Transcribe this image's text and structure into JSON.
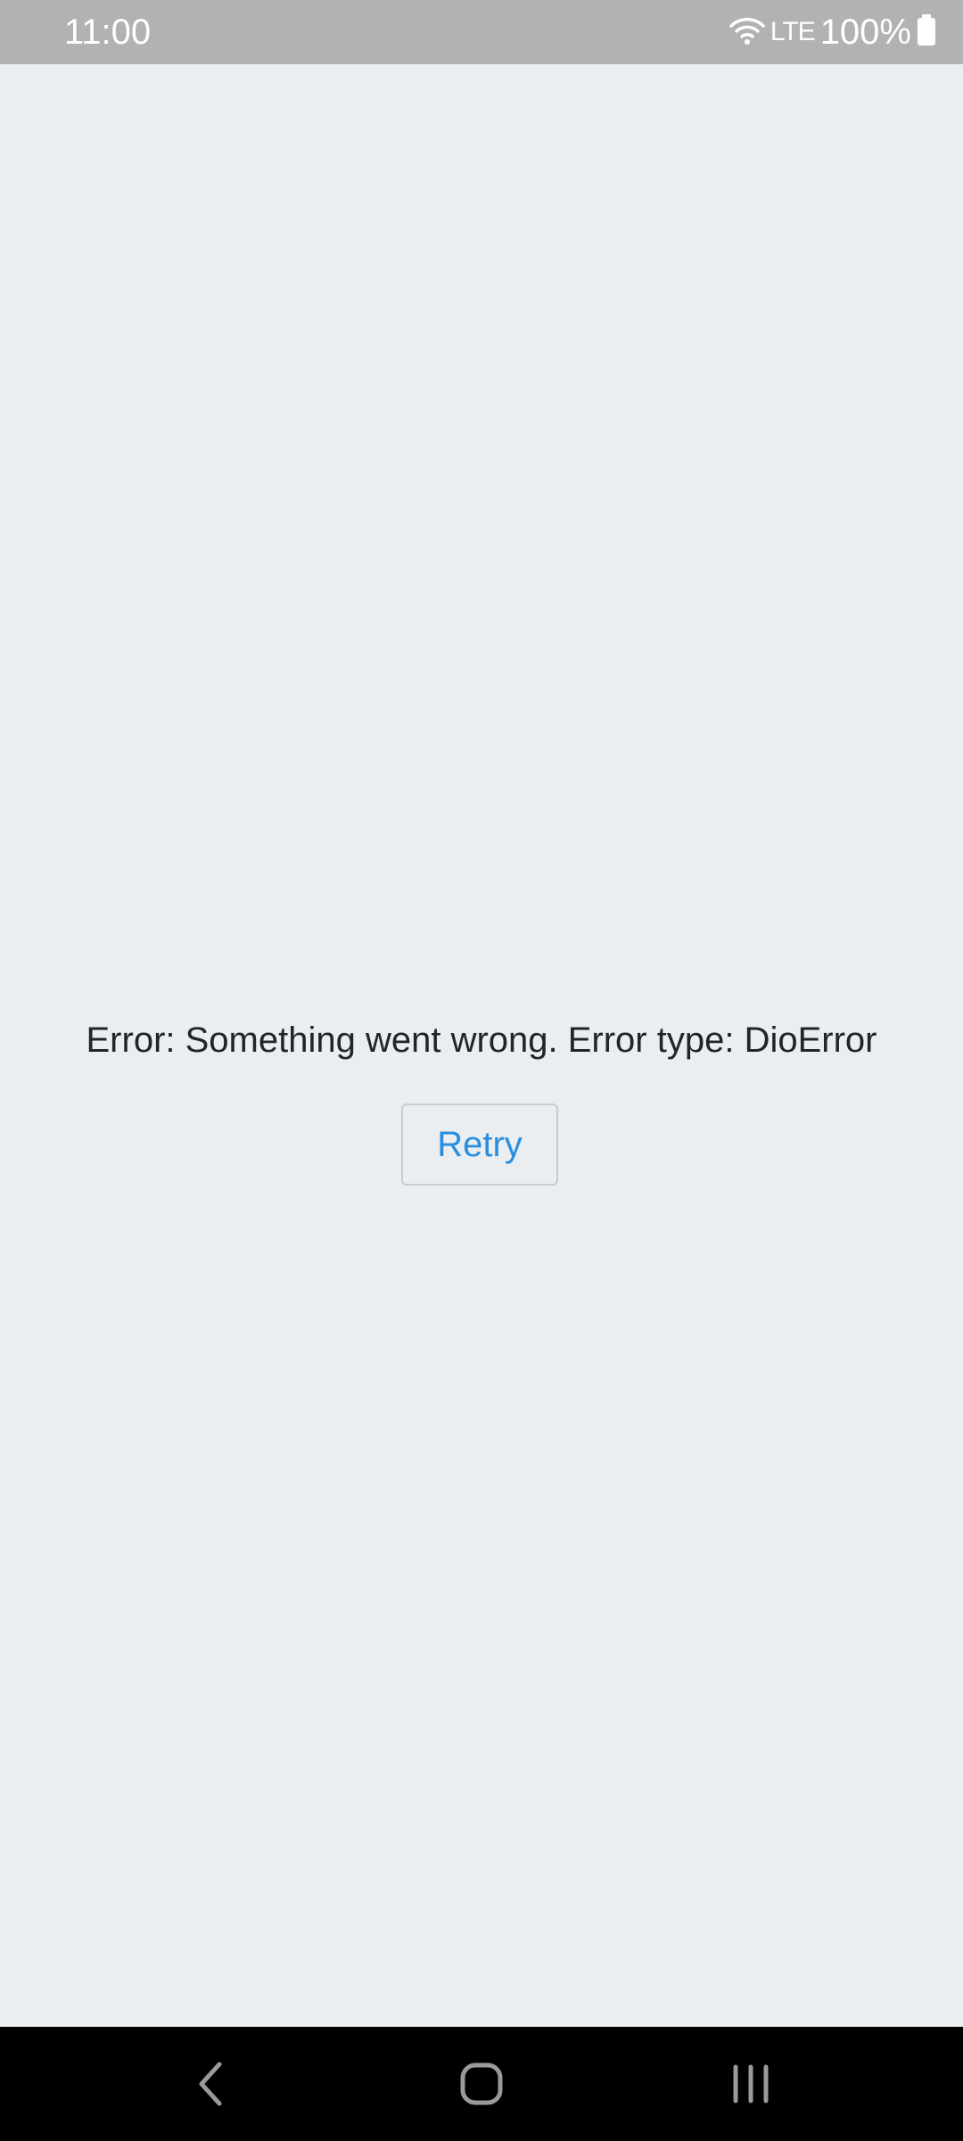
{
  "status_bar": {
    "time": "11:00",
    "network": "LTE",
    "battery": "100%",
    "icons": [
      "wifi-icon",
      "battery-icon"
    ]
  },
  "main": {
    "error_message": "Error: Something went wrong. Error type: DioError",
    "retry_label": "Retry"
  },
  "nav_bar": {
    "buttons": [
      "back-icon",
      "home-icon",
      "recents-icon"
    ]
  },
  "colors": {
    "background": "#eaeef1",
    "status_bar": "#b1b2b4",
    "accent": "#2a8ee0",
    "text": "#222428",
    "nav_bar": "#000000"
  }
}
